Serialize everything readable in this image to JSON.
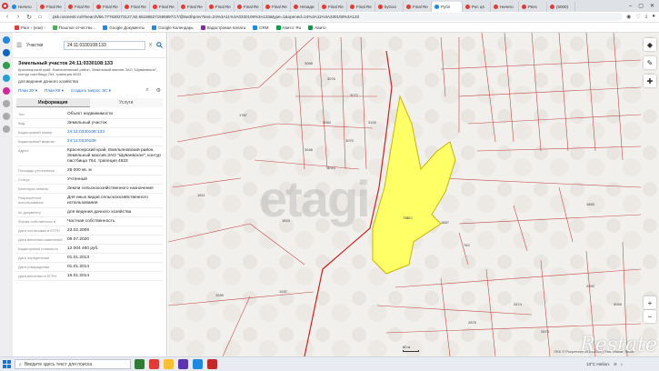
{
  "browser": {
    "tabs": [
      {
        "label": "Ничего",
        "color": "#1e88e5"
      },
      {
        "label": "Final Re",
        "color": "#e53935"
      },
      {
        "label": "Final Re",
        "color": "#e53935"
      },
      {
        "label": "Final Re",
        "color": "#e53935"
      },
      {
        "label": "Final Re",
        "color": "#e53935"
      },
      {
        "label": "Final Re",
        "color": "#e53935"
      },
      {
        "label": "Final Re",
        "color": "#e53935"
      },
      {
        "label": "Final Re",
        "color": "#e53935"
      },
      {
        "label": "Final Re",
        "color": "#e53935"
      },
      {
        "label": "Final Re",
        "color": "#e53935"
      },
      {
        "label": "Нёзади",
        "color": "#e53935"
      },
      {
        "label": "Final Re",
        "color": "#e53935"
      },
      {
        "label": "Final Re",
        "color": "#e53935"
      },
      {
        "label": "kyGоo",
        "color": "#e53935"
      },
      {
        "label": "Final Re",
        "color": "#e53935"
      },
      {
        "label": "Рубл",
        "color": "#1e88e5",
        "active": true
      },
      {
        "label": "Рос ця",
        "color": "#e53935"
      },
      {
        "label": "Ничего",
        "color": "#e53935"
      },
      {
        "label": "Реес",
        "color": "#e53935"
      },
      {
        "label": "(6000)",
        "color": "#e53935"
      }
    ],
    "url": "pkk.rosreestr.ru/#/search/56.777630273127,92.651865271596997/17/@5w3hpmv?text=24%3A11%3A0330108%3A133&type=1&opened=24%3A11%3A330108%3A133"
  },
  "bookmarks": [
    {
      "label": "Ранг › (нои) ›",
      "color": "#e53935"
    },
    {
      "label": "Пошлое отчество...",
      "color": "#4caf50"
    },
    {
      "label": "Google Документы",
      "color": "#1e88e5"
    },
    {
      "label": "Google Календарь",
      "color": "#1e88e5"
    },
    {
      "label": "Кадастровая палата",
      "color": "#8e24aa"
    },
    {
      "label": "CRM",
      "color": "#1e88e5"
    },
    {
      "label": "Авито: Ru",
      "color": "#00a046"
    },
    {
      "label": "Авито",
      "color": "#00a046"
    }
  ],
  "panel": {
    "layer_select": "Участки",
    "search_value": "24:11:0330108:133",
    "title": "Земельный участок 24:11:0330108:133",
    "address": "Красноярский край, Емельяновский район, Земельный массив ЗАО \"Шуваевское\", контур пастбища 764, трапеция 4633",
    "purpose": "для ведения дачного хозяйства",
    "link_plan_zu": "План ЗУ ▾",
    "link_plan_kk": "План КК ▾",
    "link_create_kc": "Создать запрос ЭС ▾",
    "tab_info": "Информация",
    "tab_services": "Услуги",
    "properties": [
      {
        "k": "Тип",
        "v": "Объект недвижимости"
      },
      {
        "k": "Вид",
        "v": "Земельный участок"
      },
      {
        "k": "Кадастровый номер",
        "v": "24:11:0330108:133",
        "link": true
      },
      {
        "k": "Кадастровый квартал",
        "v": "24:11:0330108",
        "link": true
      },
      {
        "k": "Адрес",
        "v": "Красноярский край, Емельяновский район, Земельный массив ЗАО \"Шуваевское\", контур пастбища 764, трапеция 4633"
      },
      {
        "k": "Площадь уточненная",
        "v": "26 000 кв. м"
      },
      {
        "k": "Статус",
        "v": "Учтенный"
      },
      {
        "k": "Категория земель",
        "v": "Земли сельскохозяйственного назначения"
      },
      {
        "k": "Разрешенное использование",
        "v": "Для иных видов сельскохозяйственного использования"
      },
      {
        "k": "по документу",
        "v": "для ведения дачного хозяйства"
      },
      {
        "k": "Форма собственности",
        "v": "Частная собственность"
      },
      {
        "k": "Дата постановки в ЕГРН",
        "v": "23.02.2009"
      },
      {
        "k": "Дата внесения изменений",
        "v": "09.07.2020"
      },
      {
        "k": "Кадастровая стоимость",
        "v": "12 004 460 руб."
      },
      {
        "k": "Дата определения",
        "v": "01.01.2013"
      },
      {
        "k": "Дата утверждения",
        "v": "01.01.2014"
      },
      {
        "k": "Дата внесения в ЕГРН",
        "v": "16.01.2014"
      }
    ]
  },
  "map": {
    "watermark": "etagi",
    "parcel_label": "133",
    "labels": [
      "1787",
      "1811",
      "1843",
      "1939",
      "1937",
      "762",
      "785",
      "1867",
      "1883",
      "3068",
      "3076",
      "3072",
      "3060",
      "3070",
      "3100",
      "3048",
      "3044",
      "2876",
      "2874",
      "2873",
      "2990",
      "3055"
    ],
    "scale_label": "80 м",
    "attribution": "ПКК © Росреестр 2010-2021 | Esri, Maxar, SIOA",
    "logo": "Restate"
  },
  "taskbar": {
    "search_placeholder": "Введите здесь текст для поиска",
    "weather": "13°C Небол.",
    "time": "",
    "apps": [
      "#2e7d32",
      "#e53935",
      "#fbc02d",
      "#5e35b1",
      "#1e88e5",
      "#c62828"
    ]
  },
  "colors": {
    "parcel_fill": "#ffff66",
    "parcel_stroke": "#c8b800",
    "boundary": "#d12020",
    "parcel_lines": "#b03030"
  }
}
